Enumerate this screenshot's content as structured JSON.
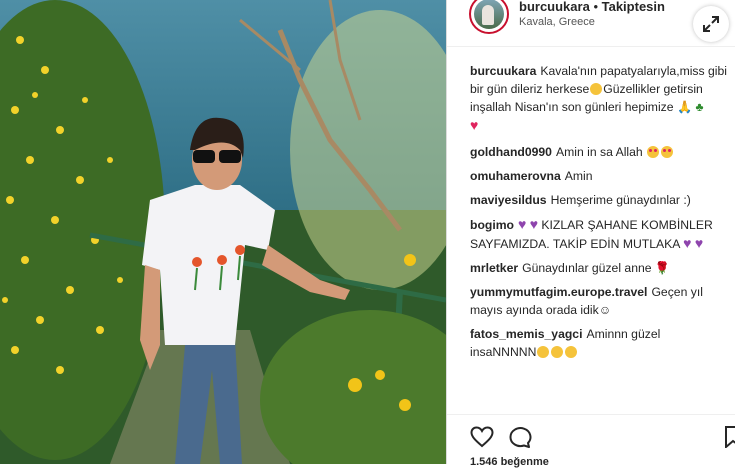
{
  "post": {
    "username": "burcuukara",
    "separator": "•",
    "follow_status": "Takiptesin",
    "location": "Kavala, Greece",
    "likes_text": "1.546 beğenme"
  },
  "comments": [
    {
      "user": "burcuukara",
      "line1": "Kavala'nın papatyalarıyla,miss gibi",
      "line2": "bir gün dileriz herkese",
      "line2b": "Güzellikler getirsin",
      "line3": "inşallah Nisan'ın son günleri hepimize"
    },
    {
      "user": "goldhand0990",
      "text": "Amin in sa Allah"
    },
    {
      "user": "omuhamerovna",
      "text": "Amin"
    },
    {
      "user": "maviyesildus",
      "text": "Hemşerime günaydınlar :)"
    },
    {
      "user": "bogimo",
      "text": "KIZLAR ŞAHANE KOMBİNLER",
      "text2": "SAYFAMIZDA. TAKİP EDİN MUTLAKA"
    },
    {
      "user": "mrletker",
      "text": "Günaydınlar güzel anne"
    },
    {
      "user": "yummymutfagim.europe.travel",
      "text": "Geçen yıl",
      "text2": "mayıs ayında orada idik"
    },
    {
      "user": "fatos_memis_yagci",
      "text": "Aminnn güzel",
      "text2": "insaNNNNN"
    }
  ],
  "icons": {
    "expand": "expand-icon",
    "like": "heart-outline-icon",
    "comment": "comment-bubble-icon",
    "save": "bookmark-icon"
  },
  "colors": {
    "text": "#262626",
    "secondary": "#8e8e8e",
    "divider": "#dbdbdb",
    "heart_red": "#e0245e",
    "heart_purple": "#8e44ad"
  }
}
